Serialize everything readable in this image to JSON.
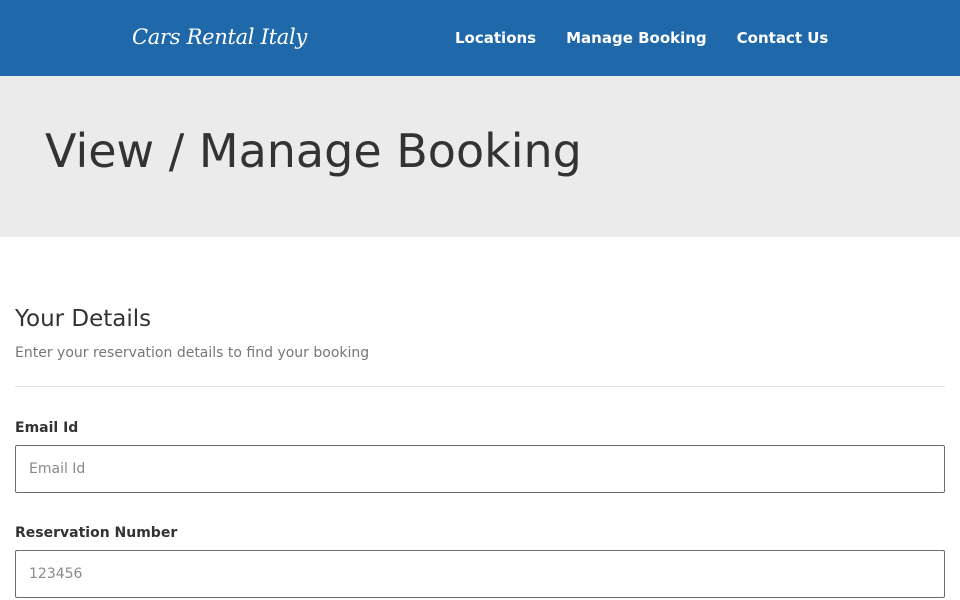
{
  "header": {
    "brand": "Cars Rental Italy",
    "nav": [
      {
        "label": "Locations"
      },
      {
        "label": "Manage Booking"
      },
      {
        "label": "Contact Us"
      }
    ],
    "background_color": "#1f69ab"
  },
  "hero": {
    "title": "View / Manage Booking",
    "background_color": "#ebebeb"
  },
  "form": {
    "section_title": "Your Details",
    "section_subtitle": "Enter your reservation details to find your booking",
    "email": {
      "label": "Email Id",
      "placeholder": "Email Id",
      "value": ""
    },
    "reservation": {
      "label": "Reservation Number",
      "placeholder": "123456",
      "value": ""
    }
  }
}
